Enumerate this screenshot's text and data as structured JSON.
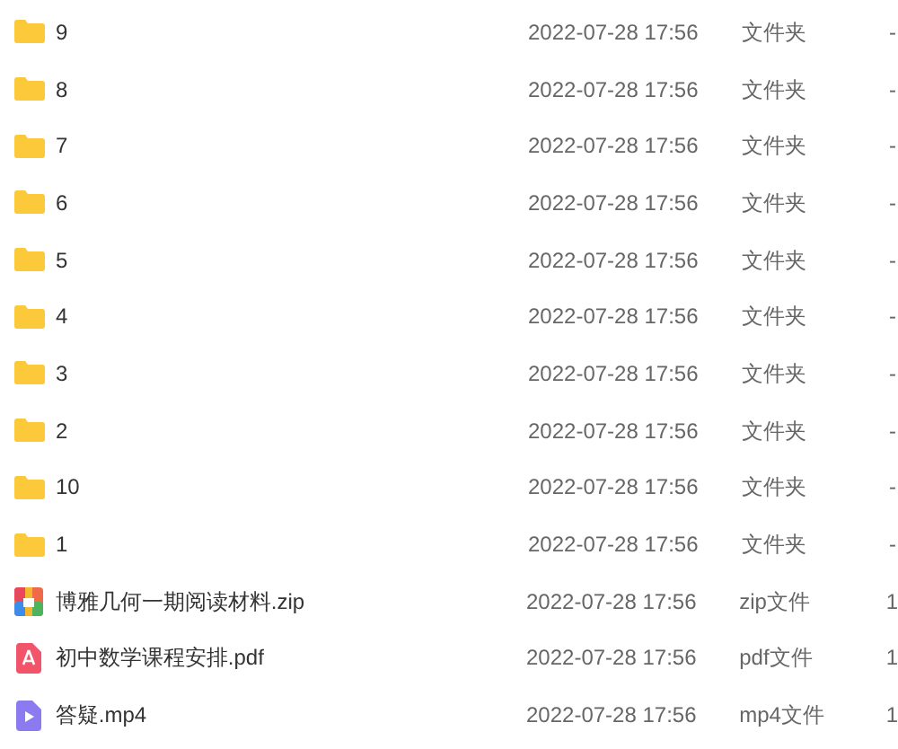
{
  "files": [
    {
      "kind": "folder",
      "name": "9",
      "date": "2022-07-28 17:56",
      "type": "文件夹",
      "size": "-"
    },
    {
      "kind": "folder",
      "name": "8",
      "date": "2022-07-28 17:56",
      "type": "文件夹",
      "size": "-"
    },
    {
      "kind": "folder",
      "name": "7",
      "date": "2022-07-28 17:56",
      "type": "文件夹",
      "size": "-"
    },
    {
      "kind": "folder",
      "name": "6",
      "date": "2022-07-28 17:56",
      "type": "文件夹",
      "size": "-"
    },
    {
      "kind": "folder",
      "name": "5",
      "date": "2022-07-28 17:56",
      "type": "文件夹",
      "size": "-"
    },
    {
      "kind": "folder",
      "name": "4",
      "date": "2022-07-28 17:56",
      "type": "文件夹",
      "size": "-"
    },
    {
      "kind": "folder",
      "name": "3",
      "date": "2022-07-28 17:56",
      "type": "文件夹",
      "size": "-"
    },
    {
      "kind": "folder",
      "name": "2",
      "date": "2022-07-28 17:56",
      "type": "文件夹",
      "size": "-"
    },
    {
      "kind": "folder",
      "name": "10",
      "date": "2022-07-28 17:56",
      "type": "文件夹",
      "size": "-"
    },
    {
      "kind": "folder",
      "name": "1",
      "date": "2022-07-28 17:56",
      "type": "文件夹",
      "size": "-"
    },
    {
      "kind": "zip",
      "name": "博雅几何一期阅读材料.zip",
      "date": "2022-07-28 17:56",
      "type": "zip文件",
      "size": "1"
    },
    {
      "kind": "pdf",
      "name": "初中数学课程安排.pdf",
      "date": "2022-07-28 17:56",
      "type": "pdf文件",
      "size": "1"
    },
    {
      "kind": "video",
      "name": "答疑.mp4",
      "date": "2022-07-28 17:56",
      "type": "mp4文件",
      "size": "1"
    }
  ]
}
